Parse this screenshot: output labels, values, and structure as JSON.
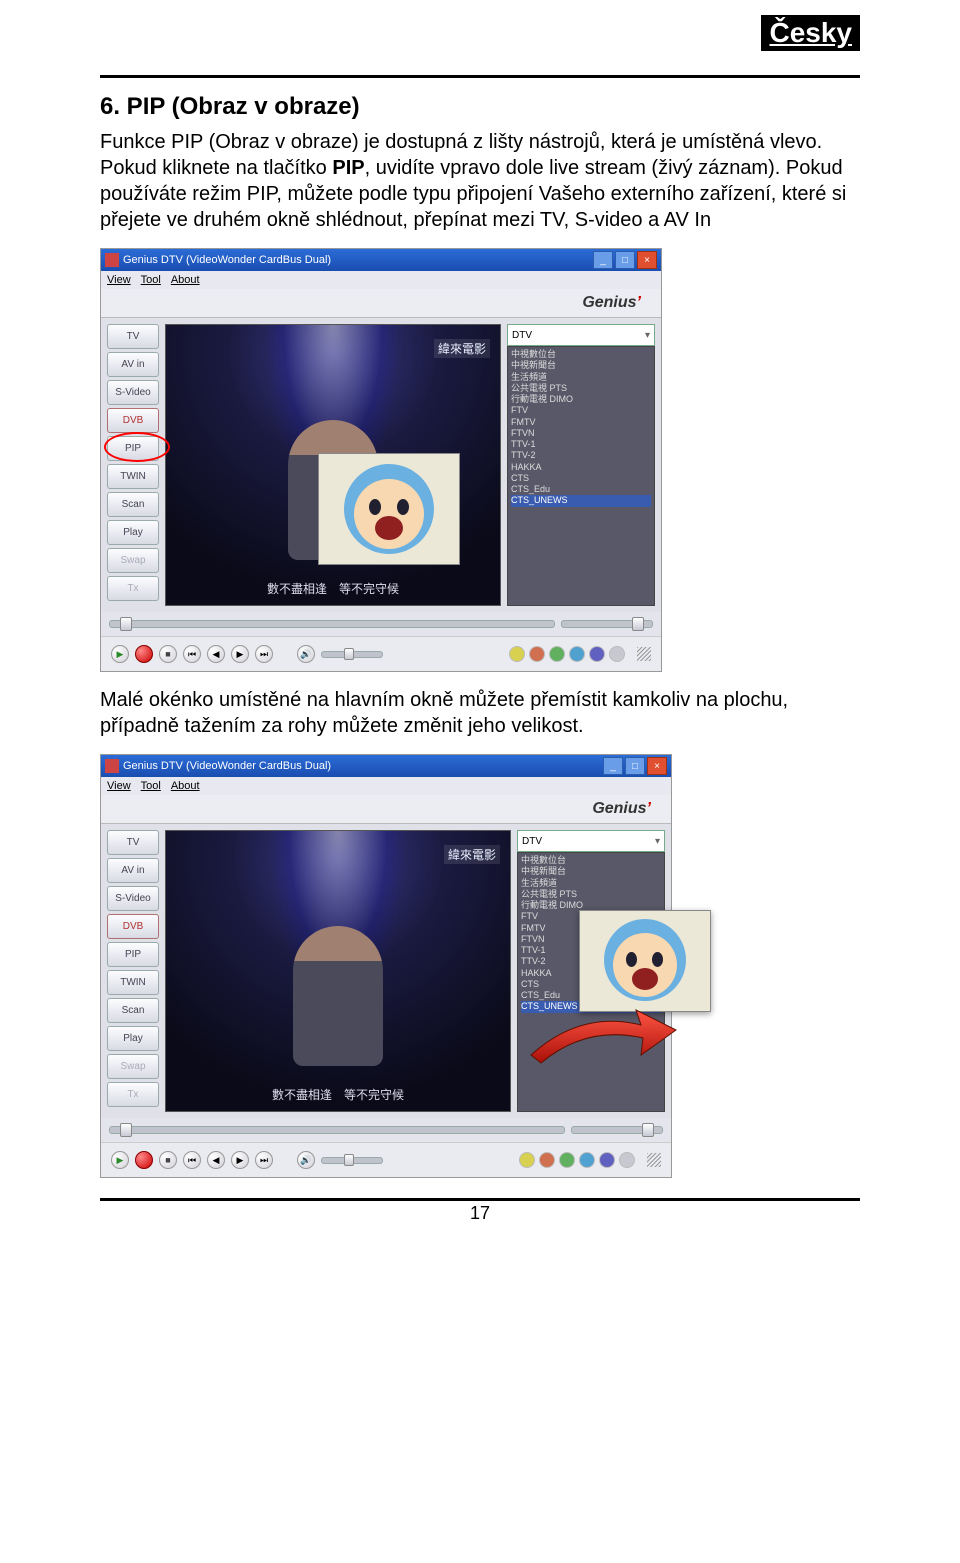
{
  "lang_badge": "Česky",
  "section_title": "6. PIP (Obraz v obraze)",
  "paragraph1": "Funkce PIP (Obraz v obraze) je dostupná z lišty nástrojů, která je umístěná vlevo. Pokud kliknete na tlačítko PIP, uvidíte vpravo dole live stream (živý záznam). Pokud používáte režim PIP, můžete podle typu připojení Vašeho externího zařízení, které si přejete ve druhém okně shlédnout, přepínat mezi TV, S-video a AV In",
  "paragraph1_bold_before": "Funkce PIP (Obraz v obraze) je dostupná z lišty nástrojů, která je umístěná vlevo. Pokud kliknete na tlačítko ",
  "paragraph1_bold_word": "PIP",
  "paragraph1_bold_after": ", uvidíte vpravo dole live stream (živý záznam). Pokud používáte režim PIP, můžete podle typu připojení Vašeho externího zařízení, které si přejete ve druhém okně shlédnout, přepínat mezi TV, S-video a AV In",
  "paragraph2": "Malé okénko umístěné na hlavním okně můžete přemístit kamkoliv na plochu, případně tažením za rohy můžete změnit jeho velikost.",
  "window": {
    "title": "Genius DTV (VideoWonder CardBus Dual)",
    "menu": {
      "view": "View",
      "tool": "Tool",
      "about": "About"
    },
    "brand": "Genius",
    "side_buttons": [
      "TV",
      "AV in",
      "S-Video",
      "DVB",
      "PIP",
      "TWIN",
      "Scan",
      "Play",
      "Swap",
      "Tx"
    ],
    "dtv_label": "DTV",
    "channels": [
      "中視數位台",
      "中視新聞台",
      "生活頻道",
      "公共電視 PTS",
      "行動電視 DIMO",
      "FTV",
      "FMTV",
      "FTVN",
      "TTV-1",
      "TTV-2",
      "HAKKA",
      "CTS",
      "CTS_Edu",
      "CTS_UNEWS"
    ],
    "overlay_logo": "緯來電影",
    "overlay_subtitle": "數不盡相逢　等不完守候",
    "color_dots": [
      "#d8d050",
      "#d07050",
      "#60b060",
      "#50a0d0",
      "#6060c0"
    ]
  },
  "page_number": "17"
}
